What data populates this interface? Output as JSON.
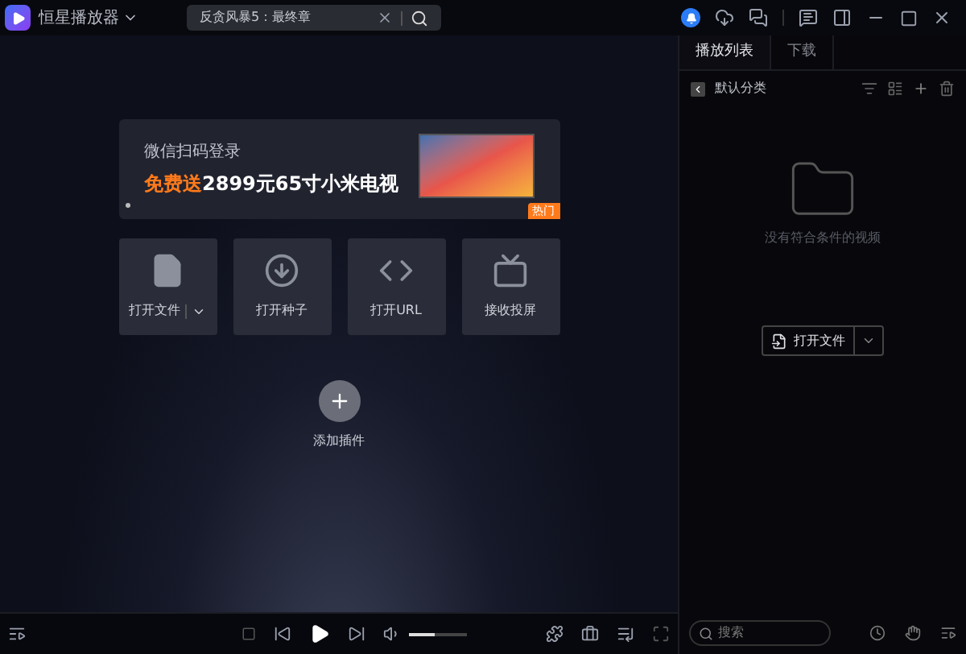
{
  "app": {
    "title": "恒星播放器"
  },
  "search": {
    "value": "反贪风暴5：最终章"
  },
  "banner": {
    "subtitle": "微信扫码登录",
    "highlight": "免费送",
    "headline": "2899元65寸小米电视",
    "badge": "热门"
  },
  "actions": [
    {
      "kind": "file",
      "label": "打开文件"
    },
    {
      "kind": "torrent",
      "label": "打开种子"
    },
    {
      "kind": "url",
      "label": "打开URL"
    },
    {
      "kind": "cast",
      "label": "接收投屏"
    }
  ],
  "plugin": {
    "label": "添加插件"
  },
  "playback": {
    "volume": {
      "level": 0.45
    }
  },
  "panel": {
    "tabs": [
      {
        "label": "播放列表",
        "selected": true
      },
      {
        "label": "下载",
        "selected": false
      }
    ],
    "category": "默认分类",
    "empty_text": "没有符合条件的视频",
    "open_button": "打开文件",
    "search_placeholder": "搜索"
  }
}
